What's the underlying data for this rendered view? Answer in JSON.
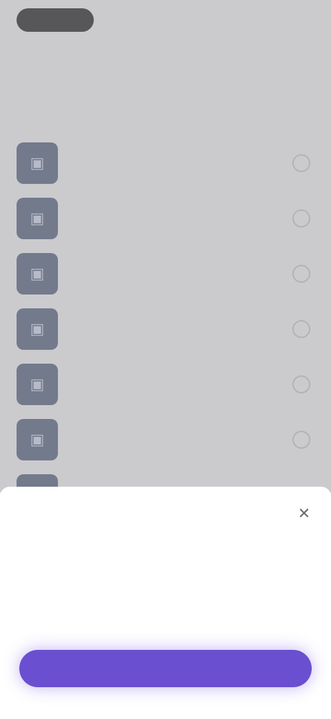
{
  "header": {
    "back_label": "",
    "title": "",
    "subtitle": ""
  },
  "list": {
    "items": [
      {
        "label": "",
        "icon": "image-icon"
      },
      {
        "label": "",
        "icon": "image-icon"
      },
      {
        "label": "",
        "icon": "image-icon"
      },
      {
        "label": "",
        "icon": "image-icon"
      },
      {
        "label": "",
        "icon": "image-icon"
      },
      {
        "label": "",
        "icon": "image-icon"
      }
    ]
  },
  "sheet": {
    "title": "",
    "body": "",
    "close_icon": "close-icon",
    "cta_label": ""
  },
  "colors": {
    "accent": "#6a4fd0",
    "thumb": "#5a6684",
    "background": "#f2f2f4",
    "sheet": "#ffffff"
  }
}
